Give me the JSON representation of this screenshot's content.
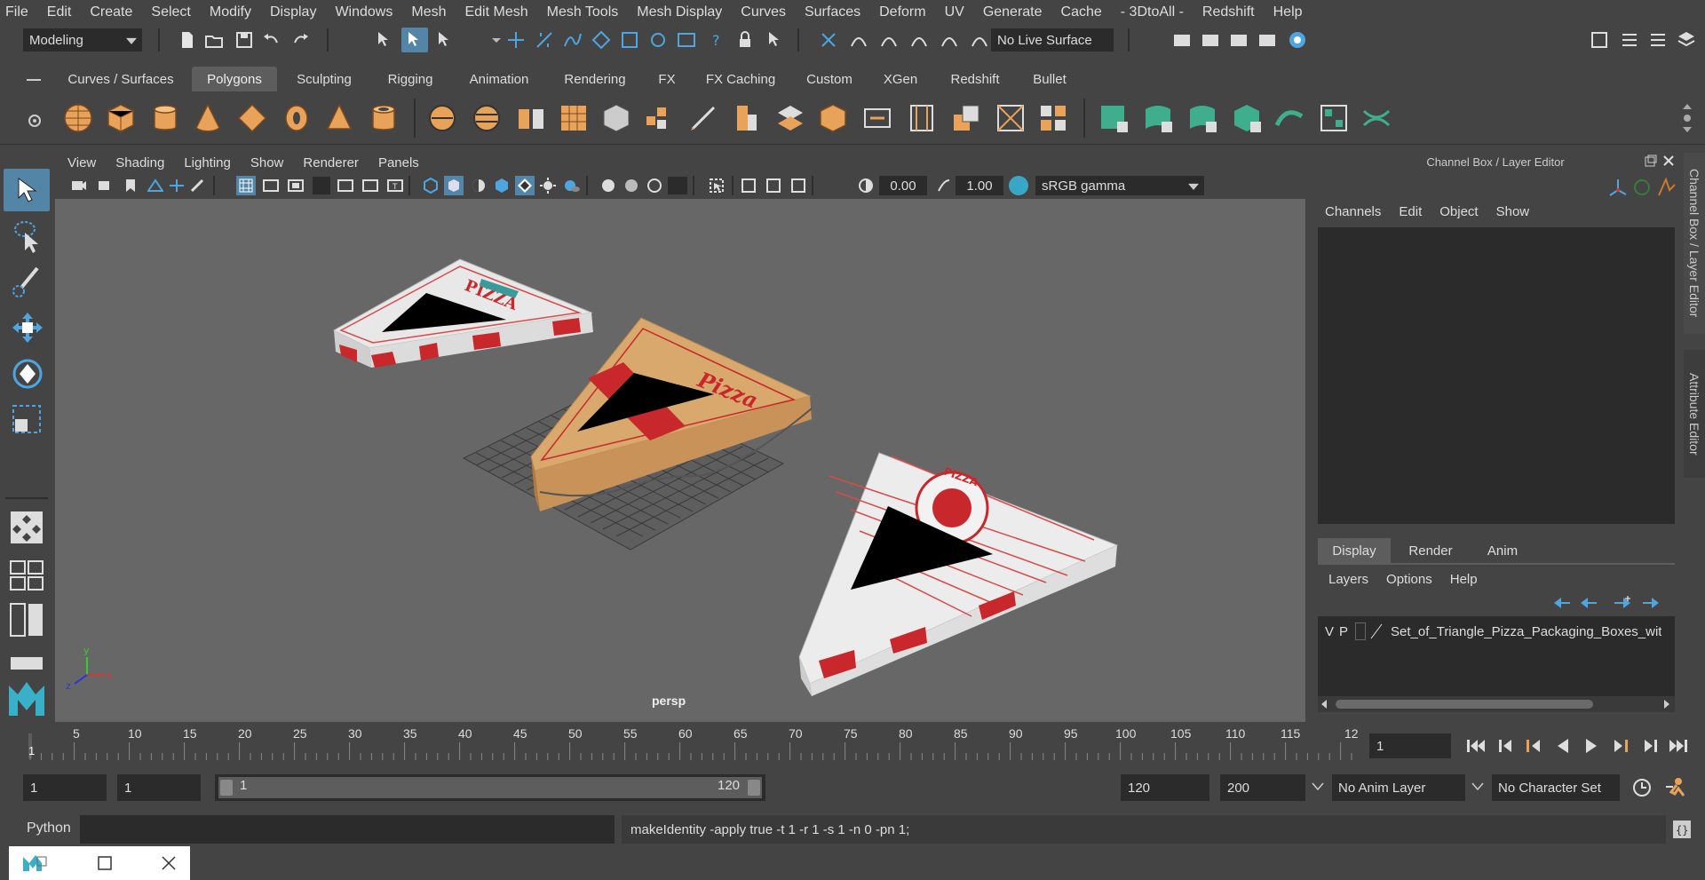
{
  "menubar": {
    "items": [
      "File",
      "Edit",
      "Create",
      "Select",
      "Modify",
      "Display",
      "Windows",
      "Mesh",
      "Edit Mesh",
      "Mesh Tools",
      "Mesh Display",
      "Curves",
      "Surfaces",
      "Deform",
      "UV",
      "Generate",
      "Cache",
      "- 3DtoAll -",
      "Redshift",
      "Help"
    ]
  },
  "statusline": {
    "mode": "Modeling",
    "live_surface": "No Live Surface"
  },
  "shelf": {
    "tabs": [
      "Curves / Surfaces",
      "Polygons",
      "Sculpting",
      "Rigging",
      "Animation",
      "Rendering",
      "FX",
      "FX Caching",
      "Custom",
      "XGen",
      "Redshift",
      "Bullet"
    ],
    "active": "Polygons"
  },
  "viewport": {
    "menu": [
      "View",
      "Shading",
      "Lighting",
      "Show",
      "Renderer",
      "Panels"
    ],
    "exposure": "0.00",
    "gamma": "1.00",
    "color_space": "sRGB gamma",
    "camera_label": "persp",
    "axis_labels": {
      "x": "x",
      "y": "y",
      "z": "z"
    },
    "box_labels": {
      "left": "PIZZA",
      "center": "Pizza",
      "right": "PIZZA"
    }
  },
  "channelbox": {
    "title": "Channel Box / Layer Editor",
    "menu": [
      "Channels",
      "Edit",
      "Object",
      "Show"
    ],
    "layer_tabs": [
      "Display",
      "Render",
      "Anim"
    ],
    "active_layer_tab": "Display",
    "layer_menu": [
      "Layers",
      "Options",
      "Help"
    ],
    "layer_row": {
      "v": "V",
      "p": "P",
      "name": "Set_of_Triangle_Pizza_Packaging_Boxes_wit"
    }
  },
  "side_tabs": {
    "channel": "Channel Box / Layer Editor",
    "attribute": "Attribute Editor"
  },
  "timeline": {
    "ticks": [
      "1",
      "5",
      "10",
      "15",
      "20",
      "25",
      "30",
      "35",
      "40",
      "45",
      "50",
      "55",
      "60",
      "65",
      "70",
      "75",
      "80",
      "85",
      "90",
      "95",
      "100",
      "105",
      "110",
      "115",
      "12"
    ],
    "current_frame": "1"
  },
  "range": {
    "start": "1",
    "anim_start": "1",
    "slider_min": "1",
    "slider_max": "120",
    "anim_end": "120",
    "end": "200",
    "anim_layer": "No Anim Layer",
    "char_set": "No Character Set"
  },
  "commandline": {
    "language": "Python",
    "result": "makeIdentity -apply true -t 1 -r 1 -s 1 -n 0 -pn 1;"
  },
  "colors": {
    "accent": "#5285a6",
    "viewport_bg": "#676767",
    "shelf_orange": "#e8a25a",
    "shelf_teal": "#3fae8c"
  }
}
